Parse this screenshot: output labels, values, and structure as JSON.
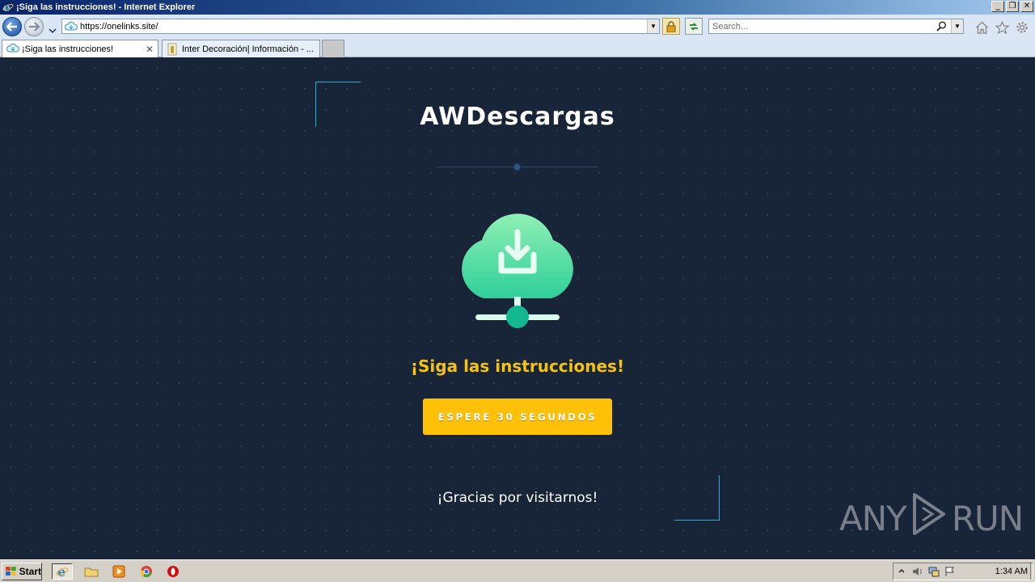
{
  "window": {
    "title": "¡Siga las instrucciones! - Internet Explorer",
    "controls": [
      "minimize",
      "restore",
      "close"
    ]
  },
  "addressbar": {
    "url": "https://onelinks.site/",
    "search_placeholder": "Search..."
  },
  "tabs": [
    {
      "label": "¡Siga las instrucciones!",
      "active": true
    },
    {
      "label": "Inter Decoración| Información - ...",
      "active": false
    }
  ],
  "page": {
    "brand": "AWDescargas",
    "headline": "¡Siga las instrucciones!",
    "button_label": "ESPERE 30 SEGUNDOS",
    "thanks": "¡Gracias por visitarnos!",
    "colors": {
      "background": "#182438",
      "accent_yellow": "#ffc107",
      "headline_yellow": "#f5c211",
      "corner_cyan": "#1fb5d6",
      "cloud_top": "#8ff0b4",
      "cloud_bottom": "#2fcf9a"
    }
  },
  "watermark": {
    "left": "ANY",
    "right": "RUN"
  },
  "taskbar": {
    "start_label": "Start",
    "pinned": [
      "internet-explorer-icon",
      "folder-icon",
      "media-player-icon",
      "chrome-icon",
      "opera-icon"
    ],
    "tray_icons": [
      "show-hidden-icon",
      "volume-icon",
      "network-icon",
      "action-center-flag-icon"
    ],
    "clock": "1:34 AM"
  }
}
